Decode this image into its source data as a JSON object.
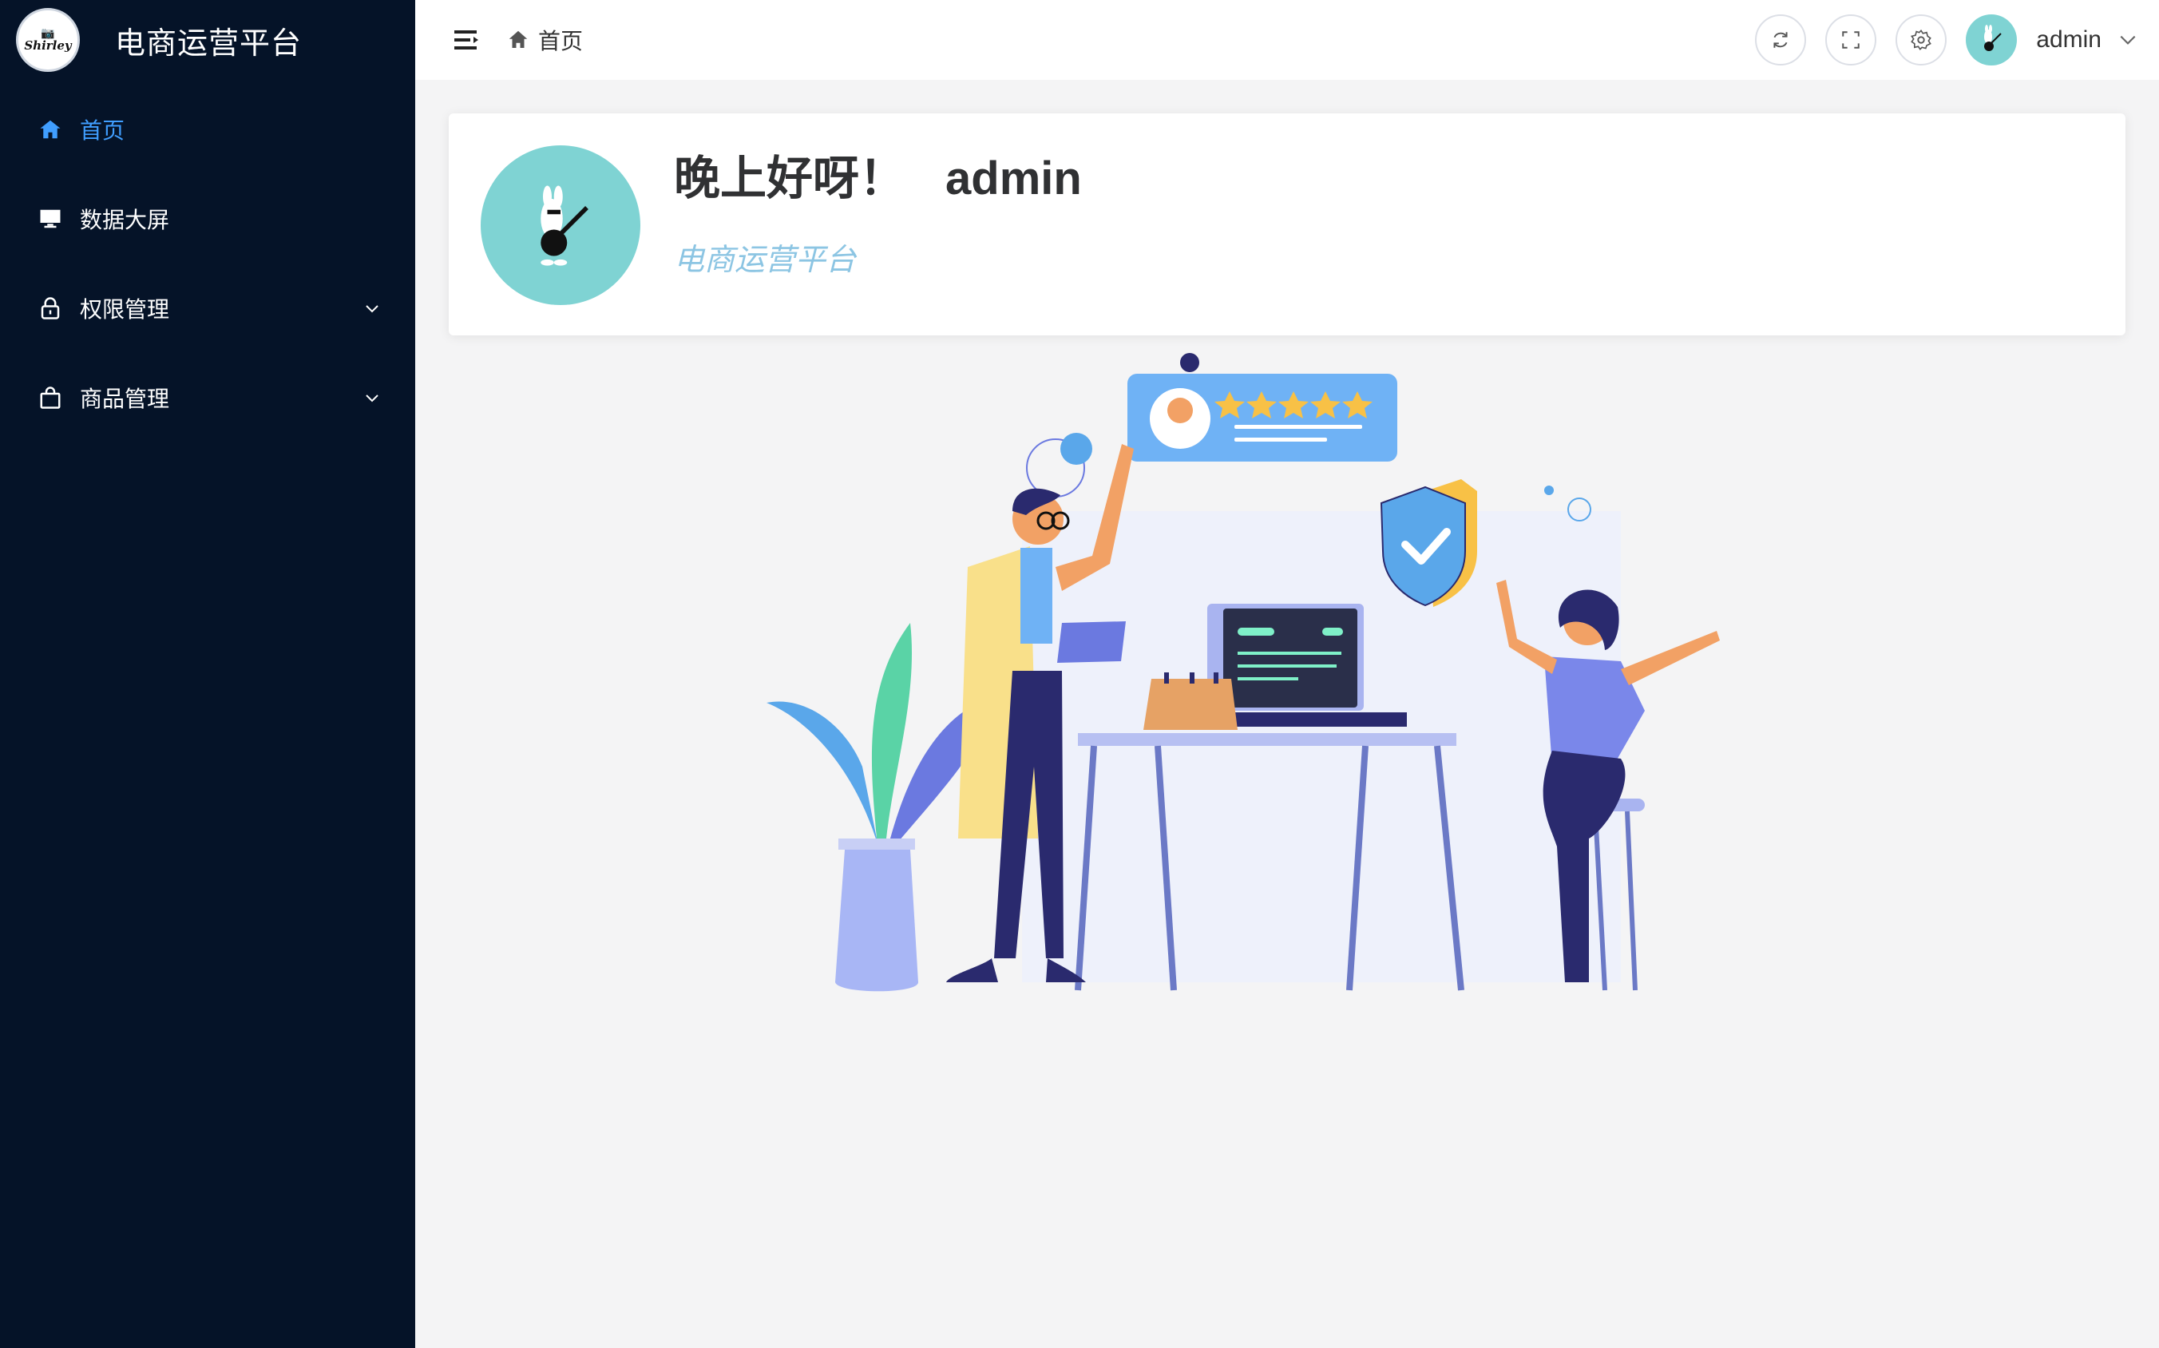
{
  "brand": {
    "logo_text": "Shirley",
    "title": "电商运营平台"
  },
  "sidebar": {
    "items": [
      {
        "label": "首页",
        "icon": "home-icon",
        "active": true,
        "has_children": false
      },
      {
        "label": "数据大屏",
        "icon": "monitor-icon",
        "active": false,
        "has_children": false
      },
      {
        "label": "权限管理",
        "icon": "lock-icon",
        "active": false,
        "has_children": true
      },
      {
        "label": "商品管理",
        "icon": "shopping-bag-icon",
        "active": false,
        "has_children": true
      }
    ]
  },
  "header": {
    "breadcrumb": [
      {
        "label": "首页",
        "icon": "home-icon"
      }
    ],
    "tools": [
      "refresh-icon",
      "fullscreen-icon",
      "settings-icon"
    ],
    "user": {
      "name": "admin"
    }
  },
  "welcome": {
    "greeting": "晚上好呀！",
    "username": "admin",
    "subtitle": "电商运营平台"
  },
  "colors": {
    "sidebar_bg": "#051328",
    "accent": "#409eff",
    "avatar_bg": "#7fd3d3",
    "subtitle": "#8cc5e3",
    "page_bg": "#f4f4f5"
  }
}
